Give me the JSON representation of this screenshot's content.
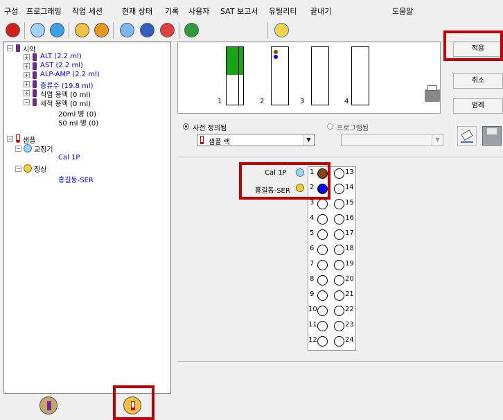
{
  "menu": [
    "구성",
    "프로그래밍",
    "작업 세션",
    "현재 상태",
    "기록",
    "사용자",
    "SAT 보고서",
    "유틸리티",
    "끝내기",
    "도움말"
  ],
  "toolbar": {
    "buttons": [
      "stop-icon",
      "snowflake-icon",
      "reagent-icon",
      "sample-icon",
      "calibration-icon",
      "monitor-icon",
      "cartridge-icon",
      "alarm-icon",
      "tools-icon",
      "weather-icon"
    ]
  },
  "tree": {
    "reagents_label": "시약",
    "reagents": [
      "ALT (2.2 ml)",
      "AST (2.2 ml)",
      "ALP-AMP (2.2 ml)",
      "증류수 (19.8 ml)",
      "식염 용액 (0 ml)",
      "세척 용액 (0 ml)"
    ],
    "wash_sub": [
      "20ml 병 (0)",
      "50 ml 병 (0)"
    ],
    "samples_label": "샘플",
    "calibrator_label": "교정기",
    "calibrator_item": "Cal 1P",
    "normal_label": "정상",
    "normal_item": "홍길동-SER"
  },
  "racks": {
    "labels": [
      "1",
      "2",
      "3",
      "4"
    ]
  },
  "buttons": {
    "apply": "적용",
    "cancel": "취소",
    "legend": "범례"
  },
  "radio": {
    "predefined": "사전 정의됨",
    "programmed": "프로그램됨"
  },
  "combo": {
    "predefined_value": "샘플 랙",
    "programmed_value": ""
  },
  "positions": {
    "left": [
      "1",
      "2",
      "3",
      "4",
      "5",
      "6",
      "7",
      "8",
      "9",
      "10",
      "11",
      "12"
    ],
    "right": [
      "13",
      "14",
      "15",
      "16",
      "17",
      "18",
      "19",
      "20",
      "21",
      "22",
      "23",
      "24"
    ],
    "assigned": [
      {
        "label": "Cal 1P",
        "position": "1",
        "color": "#8b4513"
      },
      {
        "label": "홍길동-SER",
        "position": "2",
        "color": "#0000ff"
      }
    ]
  },
  "colors": {
    "highlight": "#c00000",
    "rack_green": "#1aa31a",
    "link_blue": "#0000cc"
  }
}
